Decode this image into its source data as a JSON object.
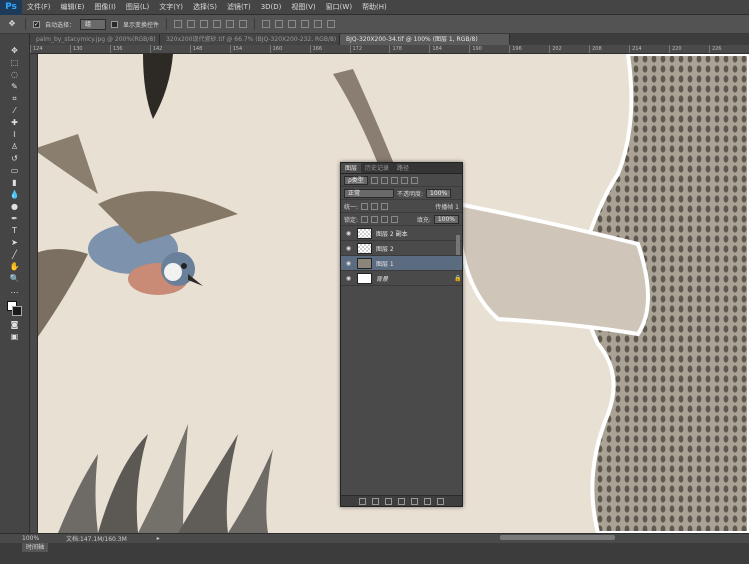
{
  "app": {
    "logo": "Ps"
  },
  "menu": [
    "文件(F)",
    "编辑(E)",
    "图像(I)",
    "图层(L)",
    "文字(Y)",
    "选择(S)",
    "滤镜(T)",
    "3D(D)",
    "视图(V)",
    "窗口(W)",
    "帮助(H)"
  ],
  "options": {
    "auto_select_label": "自动选择：",
    "auto_select_value": "组",
    "show_transform_label": "显示变换控件"
  },
  "tabs": [
    "palm_by_stacymicy.jpg @ 200%(RGB/8)",
    "320x200现代瓷砂.tif @ 66.7% (BJQ-320X200-232, RGB/8)",
    "BJQ-320X200-34.tif @ 100% (图层 1, RGB/8)"
  ],
  "ruler_ticks": [
    "124",
    "130",
    "136",
    "142",
    "148",
    "154",
    "160",
    "166",
    "172",
    "178",
    "184",
    "190",
    "196",
    "202",
    "208",
    "214",
    "220",
    "226"
  ],
  "status": {
    "zoom": "100%",
    "doc": "文档:147.1M/160.3M",
    "timeline_tab": "时间轴"
  },
  "layers_panel": {
    "tabs": [
      "图层",
      "历史记录",
      "路径"
    ],
    "kind_filter": "ρ类型",
    "blend_mode": "正常",
    "opacity_label": "不透明度:",
    "opacity_value": "100%",
    "unify_label": "统一:",
    "propagate_label": "传播帧 1",
    "lock_label": "锁定:",
    "fill_label": "填充:",
    "fill_value": "100%",
    "layers": [
      {
        "name": "图层 2 副本",
        "thumb": "checker",
        "selected": false
      },
      {
        "name": "图层 2",
        "thumb": "checker",
        "selected": false
      },
      {
        "name": "图层 1",
        "thumb": "image",
        "selected": true
      },
      {
        "name": "背景",
        "thumb": "white",
        "selected": false,
        "locked": true
      }
    ]
  },
  "colors": {
    "accent_selected": "#5b6b80",
    "canvas_bg": "#e9e0d4"
  }
}
